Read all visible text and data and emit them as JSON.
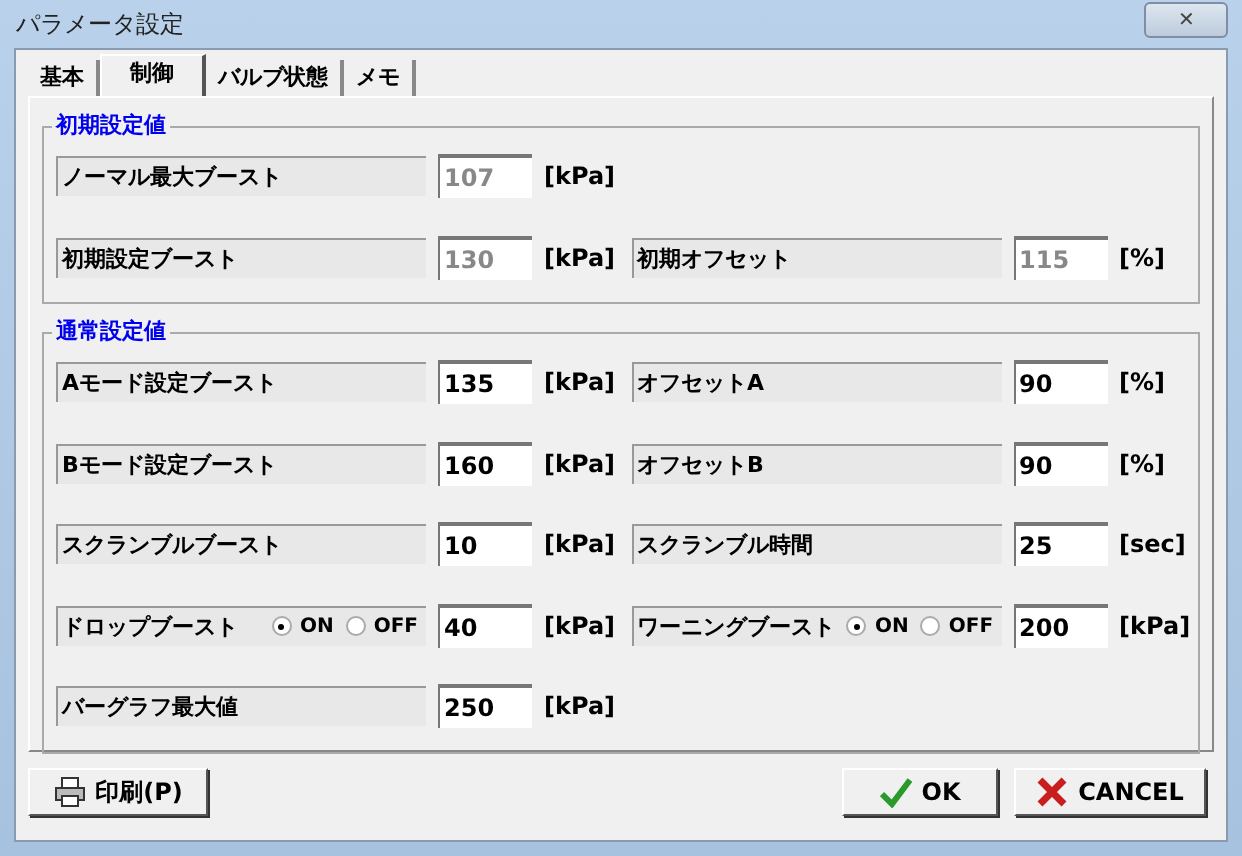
{
  "window": {
    "title": "パラメータ設定",
    "close": "✕"
  },
  "tabs": [
    {
      "label": "基本",
      "selected": false
    },
    {
      "label": "制御",
      "selected": true
    },
    {
      "label": "バルブ状態",
      "selected": false
    },
    {
      "label": "メモ",
      "selected": false
    }
  ],
  "groups": [
    {
      "title": "初期設定値",
      "rows": [
        [
          {
            "label": "ノーマル最大ブースト",
            "value": "107",
            "unit": "[kPa]",
            "disabled": true
          }
        ],
        [
          {
            "label": "初期設定ブースト",
            "value": "130",
            "unit": "[kPa]",
            "disabled": true
          },
          {
            "label": "初期オフセット",
            "value": "115",
            "unit": "[%]",
            "disabled": true
          }
        ]
      ]
    },
    {
      "title": "通常設定値",
      "rows": [
        [
          {
            "label": "Aモード設定ブースト",
            "value": "135",
            "unit": "[kPa]",
            "disabled": false
          },
          {
            "label": "オフセットA",
            "value": "90",
            "unit": "[%]",
            "disabled": false
          }
        ],
        [
          {
            "label": "Bモード設定ブースト",
            "value": "160",
            "unit": "[kPa]",
            "disabled": false
          },
          {
            "label": "オフセットB",
            "value": "90",
            "unit": "[%]",
            "disabled": false
          }
        ],
        [
          {
            "label": "スクランブルブースト",
            "value": "10",
            "unit": "[kPa]",
            "disabled": false
          },
          {
            "label": "スクランブル時間",
            "value": "25",
            "unit": "[sec]",
            "disabled": false
          }
        ],
        [
          {
            "label": "ドロップブースト",
            "value": "40",
            "unit": "[kPa]",
            "disabled": false,
            "options": [
              {
                "label": "ON",
                "selected": true
              },
              {
                "label": "OFF",
                "selected": false
              }
            ]
          },
          {
            "label": "ワーニングブースト",
            "value": "200",
            "unit": "[kPa]",
            "disabled": false,
            "options": [
              {
                "label": "ON",
                "selected": true
              },
              {
                "label": "OFF",
                "selected": false
              }
            ]
          }
        ],
        [
          {
            "label": "バーグラフ最大値",
            "value": "250",
            "unit": "[kPa]",
            "disabled": false
          }
        ]
      ]
    }
  ],
  "buttons": [
    {
      "kind": "print",
      "label": "印刷(P)"
    },
    {
      "kind": "ok",
      "label": "OK"
    },
    {
      "kind": "cancel",
      "label": "CANCEL"
    }
  ]
}
